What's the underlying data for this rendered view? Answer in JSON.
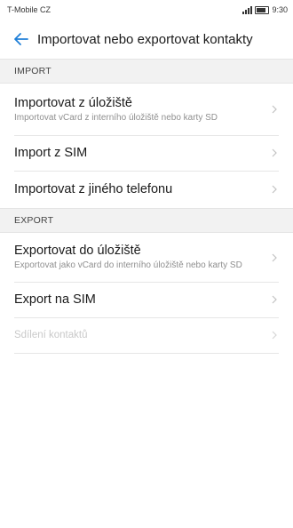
{
  "status_bar": {
    "carrier": "T-Mobile CZ",
    "time": "9:30"
  },
  "header": {
    "title": "Importovat nebo exportovat kontakty"
  },
  "sections": [
    {
      "label": "IMPORT",
      "items": [
        {
          "title": "Importovat z úložiště",
          "subtitle": "Importovat vCard z interního úložiště nebo karty SD"
        },
        {
          "title": "Import z SIM"
        },
        {
          "title": "Importovat z jiného telefonu"
        }
      ]
    },
    {
      "label": "EXPORT",
      "items": [
        {
          "title": "Exportovat do úložiště",
          "subtitle": "Exportovat jako vCard do interního úložiště nebo karty SD"
        },
        {
          "title": "Export na SIM"
        },
        {
          "title": "Sdílení kontaktů"
        }
      ]
    }
  ],
  "colors": {
    "accent": "#1f7fd8",
    "section_bg": "#f2f2f2",
    "chevron": "#c2c2c2",
    "disabled_text": "#c9c9c9"
  },
  "icons": {
    "back": "arrow-left-icon",
    "chevron": "chevron-right-icon"
  }
}
